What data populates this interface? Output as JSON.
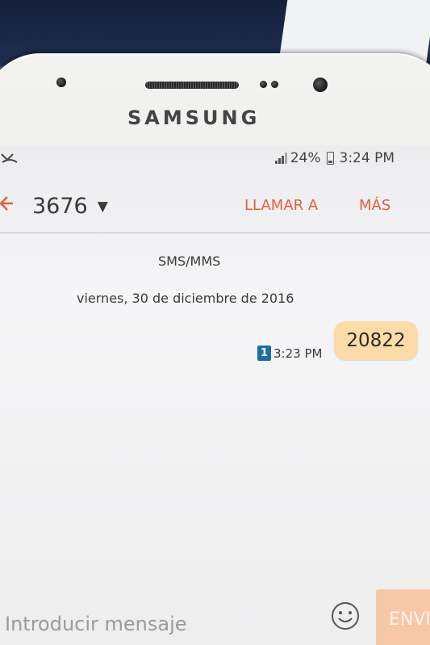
{
  "device": {
    "brand": "SAMSUNG"
  },
  "statusbar": {
    "left_icon": "missed-call-icon",
    "battery_level": "24%",
    "time": "3:24 PM"
  },
  "toolbar": {
    "back_icon": "back-arrow-icon",
    "contact": "3676",
    "call_label": "LLAMAR A",
    "more_label": "MÁS"
  },
  "conversation": {
    "channel_label": "SMS/MMS",
    "date": "viernes, 30 de diciembre de 2016",
    "messages": [
      {
        "text": "20822",
        "time": "3:23 PM",
        "sim": "1",
        "direction": "outgoing"
      }
    ]
  },
  "composer": {
    "placeholder": "Introducir mensaje",
    "emoji_icon": "smiley-icon",
    "send_label": "ENVIAR"
  },
  "colors": {
    "accent": "#e2603a",
    "bubble": "#fbdba7",
    "sim_badge": "#1f6fa6",
    "send_button": "#f6c8a6"
  }
}
